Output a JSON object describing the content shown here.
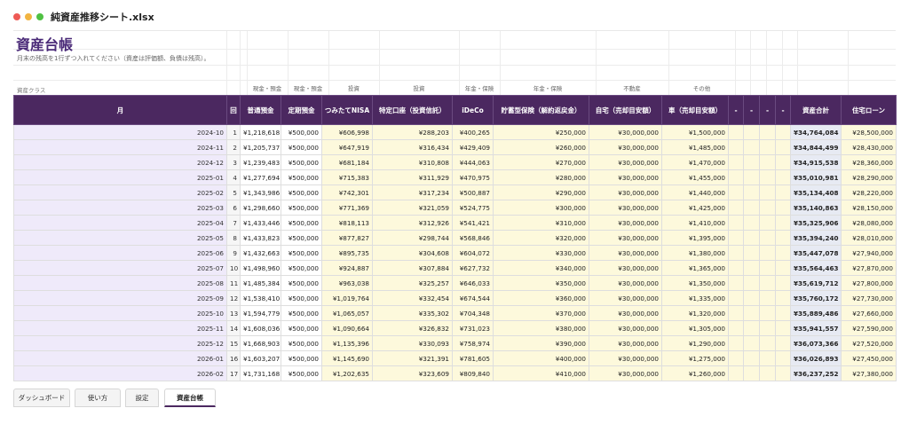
{
  "window": {
    "filename": "純資産推移シート.xlsx"
  },
  "sheet": {
    "title": "資産台帳",
    "note": "月末の残高を1行ずつ入れてください（資産は評価額、負債は残高）。",
    "class_label": "資産クラス"
  },
  "group_labels": [
    "現金・預金",
    "現金・預金",
    "投資",
    "投資",
    "年金・保険",
    "年金・保険",
    "不動産",
    "その他"
  ],
  "columns": [
    "月",
    "回",
    "普通預金",
    "定期預金",
    "つみたてNISA",
    "特定口座（投資信託）",
    "iDeCo",
    "貯蓄型保険（解約返戻金）",
    "自宅（売却目安額）",
    "車（売却目安額）",
    "-",
    "-",
    "-",
    "-",
    "資産合計",
    "住宅ローン"
  ],
  "rows": [
    [
      "2024-10",
      "1",
      "¥1,218,618",
      "¥500,000",
      "¥606,998",
      "¥288,203",
      "¥400,265",
      "¥250,000",
      "¥30,000,000",
      "¥1,500,000",
      "",
      "",
      "",
      "",
      "¥34,764,084",
      "¥28,500,000"
    ],
    [
      "2024-11",
      "2",
      "¥1,205,737",
      "¥500,000",
      "¥647,919",
      "¥316,434",
      "¥429,409",
      "¥260,000",
      "¥30,000,000",
      "¥1,485,000",
      "",
      "",
      "",
      "",
      "¥34,844,499",
      "¥28,430,000"
    ],
    [
      "2024-12",
      "3",
      "¥1,239,483",
      "¥500,000",
      "¥681,184",
      "¥310,808",
      "¥444,063",
      "¥270,000",
      "¥30,000,000",
      "¥1,470,000",
      "",
      "",
      "",
      "",
      "¥34,915,538",
      "¥28,360,000"
    ],
    [
      "2025-01",
      "4",
      "¥1,277,694",
      "¥500,000",
      "¥715,383",
      "¥311,929",
      "¥470,975",
      "¥280,000",
      "¥30,000,000",
      "¥1,455,000",
      "",
      "",
      "",
      "",
      "¥35,010,981",
      "¥28,290,000"
    ],
    [
      "2025-02",
      "5",
      "¥1,343,986",
      "¥500,000",
      "¥742,301",
      "¥317,234",
      "¥500,887",
      "¥290,000",
      "¥30,000,000",
      "¥1,440,000",
      "",
      "",
      "",
      "",
      "¥35,134,408",
      "¥28,220,000"
    ],
    [
      "2025-03",
      "6",
      "¥1,298,660",
      "¥500,000",
      "¥771,369",
      "¥321,059",
      "¥524,775",
      "¥300,000",
      "¥30,000,000",
      "¥1,425,000",
      "",
      "",
      "",
      "",
      "¥35,140,863",
      "¥28,150,000"
    ],
    [
      "2025-04",
      "7",
      "¥1,433,446",
      "¥500,000",
      "¥818,113",
      "¥312,926",
      "¥541,421",
      "¥310,000",
      "¥30,000,000",
      "¥1,410,000",
      "",
      "",
      "",
      "",
      "¥35,325,906",
      "¥28,080,000"
    ],
    [
      "2025-05",
      "8",
      "¥1,433,823",
      "¥500,000",
      "¥877,827",
      "¥298,744",
      "¥568,846",
      "¥320,000",
      "¥30,000,000",
      "¥1,395,000",
      "",
      "",
      "",
      "",
      "¥35,394,240",
      "¥28,010,000"
    ],
    [
      "2025-06",
      "9",
      "¥1,432,663",
      "¥500,000",
      "¥895,735",
      "¥304,608",
      "¥604,072",
      "¥330,000",
      "¥30,000,000",
      "¥1,380,000",
      "",
      "",
      "",
      "",
      "¥35,447,078",
      "¥27,940,000"
    ],
    [
      "2025-07",
      "10",
      "¥1,498,960",
      "¥500,000",
      "¥924,887",
      "¥307,884",
      "¥627,732",
      "¥340,000",
      "¥30,000,000",
      "¥1,365,000",
      "",
      "",
      "",
      "",
      "¥35,564,463",
      "¥27,870,000"
    ],
    [
      "2025-08",
      "11",
      "¥1,485,384",
      "¥500,000",
      "¥963,038",
      "¥325,257",
      "¥646,033",
      "¥350,000",
      "¥30,000,000",
      "¥1,350,000",
      "",
      "",
      "",
      "",
      "¥35,619,712",
      "¥27,800,000"
    ],
    [
      "2025-09",
      "12",
      "¥1,538,410",
      "¥500,000",
      "¥1,019,764",
      "¥332,454",
      "¥674,544",
      "¥360,000",
      "¥30,000,000",
      "¥1,335,000",
      "",
      "",
      "",
      "",
      "¥35,760,172",
      "¥27,730,000"
    ],
    [
      "2025-10",
      "13",
      "¥1,594,779",
      "¥500,000",
      "¥1,065,057",
      "¥335,302",
      "¥704,348",
      "¥370,000",
      "¥30,000,000",
      "¥1,320,000",
      "",
      "",
      "",
      "",
      "¥35,889,486",
      "¥27,660,000"
    ],
    [
      "2025-11",
      "14",
      "¥1,608,036",
      "¥500,000",
      "¥1,090,664",
      "¥326,832",
      "¥731,023",
      "¥380,000",
      "¥30,000,000",
      "¥1,305,000",
      "",
      "",
      "",
      "",
      "¥35,941,557",
      "¥27,590,000"
    ],
    [
      "2025-12",
      "15",
      "¥1,668,903",
      "¥500,000",
      "¥1,135,396",
      "¥330,093",
      "¥758,974",
      "¥390,000",
      "¥30,000,000",
      "¥1,290,000",
      "",
      "",
      "",
      "",
      "¥36,073,366",
      "¥27,520,000"
    ],
    [
      "2026-01",
      "16",
      "¥1,603,207",
      "¥500,000",
      "¥1,145,690",
      "¥321,391",
      "¥781,605",
      "¥400,000",
      "¥30,000,000",
      "¥1,275,000",
      "",
      "",
      "",
      "",
      "¥36,026,893",
      "¥27,450,000"
    ],
    [
      "2026-02",
      "17",
      "¥1,731,168",
      "¥500,000",
      "¥1,202,635",
      "¥323,609",
      "¥809,840",
      "¥410,000",
      "¥30,000,000",
      "¥1,260,000",
      "",
      "",
      "",
      "",
      "¥36,237,252",
      "¥27,380,000"
    ]
  ],
  "tabs": [
    {
      "label": "ダッシュボード",
      "active": false
    },
    {
      "label": "使い方",
      "active": false
    },
    {
      "label": "設定",
      "active": false
    },
    {
      "label": "資産台帳",
      "active": true
    }
  ],
  "colors": {
    "header_bg": "#4b2860",
    "title": "#4a2a78",
    "month_bg": "#efeafa",
    "asset_bg": "#fdf9dc",
    "total_bg": "#e7eaf3"
  }
}
